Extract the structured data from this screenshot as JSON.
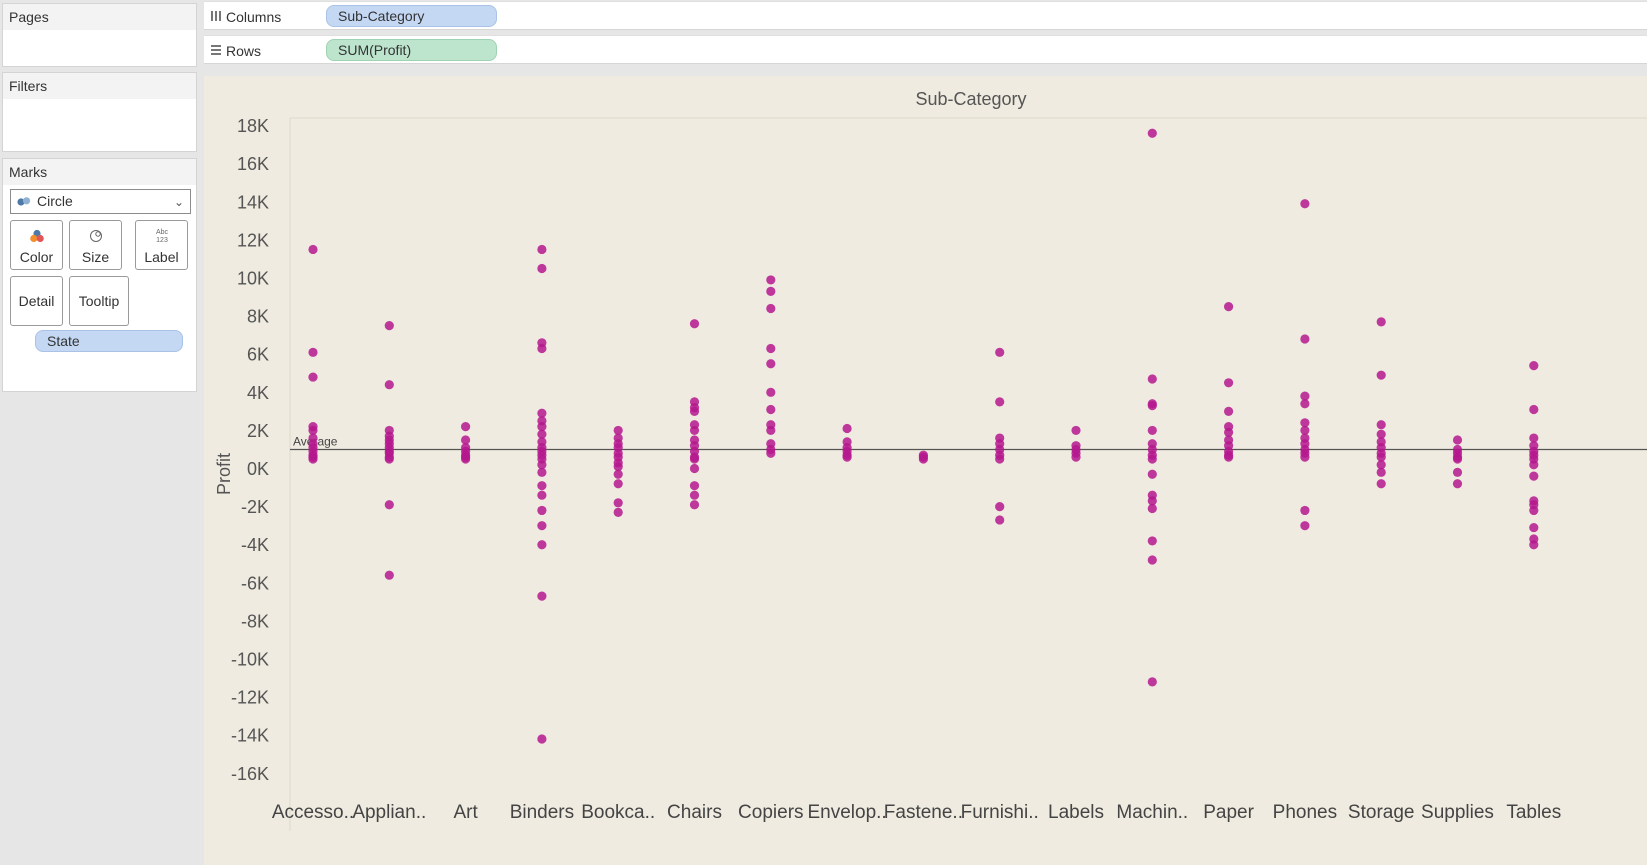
{
  "pages_card": {
    "title": "Pages"
  },
  "filters_card": {
    "title": "Filters"
  },
  "marks_card": {
    "title": "Marks",
    "mark_type": "Circle",
    "buttons": {
      "color": "Color",
      "size": "Size",
      "label": "Label",
      "detail": "Detail",
      "tooltip": "Tooltip"
    },
    "detail_pill": "State"
  },
  "shelves": {
    "columns_label": "Columns",
    "columns_pill": "Sub-Category",
    "rows_label": "Rows",
    "rows_pill": "SUM(Profit)"
  },
  "colors": {
    "mark": "#b5178e",
    "reference_line": "#555555"
  },
  "chart_data": {
    "type": "scatter",
    "title": "Sub-Category",
    "ylabel": "Profit",
    "ylim": [
      -17000,
      18500
    ],
    "yticks": [
      18000,
      16000,
      14000,
      12000,
      10000,
      8000,
      6000,
      4000,
      2000,
      0,
      -2000,
      -4000,
      -6000,
      -8000,
      -10000,
      -12000,
      -14000,
      -16000
    ],
    "ytick_labels": [
      "18K",
      "16K",
      "14K",
      "12K",
      "10K",
      "8K",
      "6K",
      "4K",
      "2K",
      "0K",
      "-2K",
      "-4K",
      "-6K",
      "-8K",
      "-10K",
      "-12K",
      "-14K",
      "-16K"
    ],
    "reference_line": {
      "label": "Average",
      "value": 500
    },
    "categories": [
      "Accesso..",
      "Applian..",
      "Art",
      "Binders",
      "Bookca..",
      "Chairs",
      "Copiers",
      "Envelop..",
      "Fastene..",
      "Furnishi..",
      "Labels",
      "Machin..",
      "Paper",
      "Phones",
      "Storage",
      "Supplies",
      "Tables"
    ],
    "series": [
      {
        "name": "State",
        "points": [
          [
            11000,
            5600,
            4300,
            1700,
            1500,
            1100,
            800,
            600,
            400,
            200,
            100,
            0
          ],
          [
            7000,
            3900,
            1500,
            1200,
            1000,
            800,
            600,
            400,
            300,
            100,
            0,
            -2400,
            -6100
          ],
          [
            1700,
            1000,
            600,
            400,
            200,
            100,
            0
          ],
          [
            11000,
            10000,
            6100,
            5800,
            2400,
            2000,
            1700,
            1300,
            900,
            600,
            400,
            200,
            0,
            -300,
            -700,
            -1400,
            -1900,
            -2700,
            -3500,
            -4500,
            -7200,
            -14700
          ],
          [
            1500,
            1100,
            800,
            600,
            300,
            100,
            -200,
            -400,
            -800,
            -1300,
            -2300,
            -2800
          ],
          [
            7100,
            3000,
            2700,
            2500,
            1800,
            1500,
            1000,
            700,
            400,
            100,
            0,
            -500,
            -1400,
            -1900,
            -2400
          ],
          [
            9400,
            8800,
            7900,
            5800,
            5000,
            3500,
            2600,
            1800,
            1500,
            800,
            500,
            300
          ],
          [
            1600,
            900,
            600,
            400,
            200,
            100
          ],
          [
            200,
            100,
            0
          ],
          [
            5600,
            3000,
            1100,
            800,
            500,
            200,
            0,
            -2500,
            -3200
          ],
          [
            1500,
            700,
            500,
            300,
            100
          ],
          [
            17100,
            4200,
            2900,
            2800,
            1500,
            800,
            500,
            200,
            0,
            -800,
            -1900,
            -2200,
            -2600,
            -4300,
            -5300,
            -11700
          ],
          [
            8000,
            4000,
            2500,
            1700,
            1400,
            1000,
            700,
            400,
            200,
            100
          ],
          [
            13400,
            6300,
            3300,
            2900,
            1900,
            1500,
            1100,
            800,
            500,
            300,
            100,
            -2700,
            -3500
          ],
          [
            7200,
            4400,
            1800,
            1300,
            900,
            600,
            300,
            100,
            -300,
            -700,
            -1300
          ],
          [
            1000,
            500,
            300,
            100,
            0,
            -700,
            -1300
          ],
          [
            4900,
            2600,
            1100,
            700,
            400,
            200,
            0,
            -300,
            -900,
            -2200,
            -2400,
            -2700,
            -3600,
            -4200,
            -4500
          ]
        ]
      }
    ]
  }
}
